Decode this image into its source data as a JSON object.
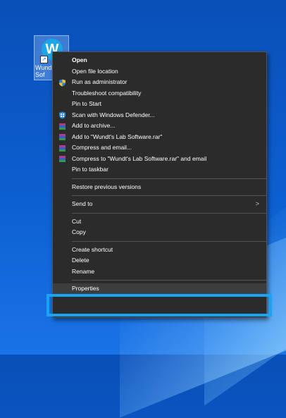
{
  "desktop": {
    "icon_letter": "W",
    "icon_label_line1": "Wund",
    "icon_label_line2": "Sof"
  },
  "context_menu": {
    "items": [
      {
        "label": "Open",
        "bold": true
      },
      {
        "label": "Open file location"
      },
      {
        "label": "Run as administrator",
        "icon": "shield-uac-icon"
      },
      {
        "label": "Troubleshoot compatibility"
      },
      {
        "label": "Pin to Start"
      },
      {
        "label": "Scan with Windows Defender...",
        "icon": "windows-defender-icon"
      },
      {
        "label": "Add to archive...",
        "icon": "winrar-icon"
      },
      {
        "label": "Add to \"Wundt's Lab Software.rar\"",
        "icon": "winrar-icon"
      },
      {
        "label": "Compress and email...",
        "icon": "winrar-icon"
      },
      {
        "label": "Compress to \"Wundt's Lab Software.rar\" and email",
        "icon": "winrar-icon"
      },
      {
        "label": "Pin to taskbar"
      },
      {
        "label": "Restore previous versions"
      },
      {
        "label": "Send to",
        "submenu": true
      },
      {
        "label": "Cut"
      },
      {
        "label": "Copy"
      },
      {
        "label": "Create shortcut"
      },
      {
        "label": "Delete"
      },
      {
        "label": "Rename"
      },
      {
        "label": "Properties",
        "highlighted": true
      }
    ],
    "submenu_arrow": ">"
  },
  "colors": {
    "menu_bg": "#2b2b2b",
    "highlight_frame": "#1aa3f0",
    "desktop_bg": "#0c5fd0"
  }
}
